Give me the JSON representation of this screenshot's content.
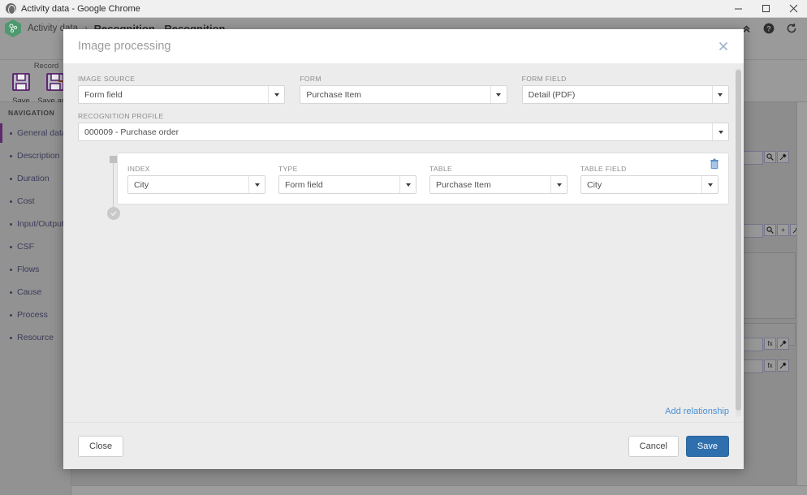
{
  "window": {
    "title": "Activity data - Google Chrome",
    "globe_icon": "chrome-globe-icon",
    "minimize": "–",
    "maximize": "☐",
    "close": "✕"
  },
  "app": {
    "breadcrumb_root": "Activity data",
    "breadcrumb_sep": "›",
    "breadcrumb_current": "Recognition - Recognition",
    "header_icons": [
      "collapse-up-icon",
      "help-icon",
      "refresh-icon"
    ],
    "ribbon": {
      "group_label": "Record",
      "buttons": [
        {
          "label": "Save",
          "icon": "save-icon"
        },
        {
          "label": "Save and c",
          "icon": "save-and-close-icon"
        }
      ]
    },
    "sidebar": {
      "title": "NAVIGATION",
      "items": [
        {
          "label": "General data",
          "active": true
        },
        {
          "label": "Description",
          "active": false
        },
        {
          "label": "Duration",
          "active": false
        },
        {
          "label": "Cost",
          "active": false
        },
        {
          "label": "Input/Output",
          "active": false
        },
        {
          "label": "CSF",
          "active": false
        },
        {
          "label": "Flows",
          "active": false
        },
        {
          "label": "Cause",
          "active": false
        },
        {
          "label": "Process",
          "active": false
        },
        {
          "label": "Resource",
          "active": false
        }
      ]
    },
    "background_icons": {
      "search": "⚲",
      "picker": "✒",
      "plus": "+",
      "fx": "fx"
    }
  },
  "dialog": {
    "title": "Image processing",
    "close_icon": "close-icon",
    "fields": [
      {
        "label": "IMAGE SOURCE",
        "value": "Form field"
      },
      {
        "label": "FORM",
        "value": "Purchase Item"
      },
      {
        "label": "FORM FIELD",
        "value": "Detail (PDF)"
      }
    ],
    "profile": {
      "label": "RECOGNITION PROFILE",
      "value": "000009 - Purchase order"
    },
    "relationship": {
      "delete_icon": "trash-icon",
      "status_icon": "check-circle-icon",
      "node_icon": "node-square-icon",
      "fields": [
        {
          "label": "INDEX",
          "value": "City"
        },
        {
          "label": "TYPE",
          "value": "Form field"
        },
        {
          "label": "TABLE",
          "value": "Purchase Item"
        },
        {
          "label": "TABLE FIELD",
          "value": "City"
        }
      ]
    },
    "add_relationship_label": "Add relationship",
    "buttons": {
      "close": "Close",
      "cancel": "Cancel",
      "save": "Save"
    },
    "accent_color": "#2f6fae",
    "link_color": "#4a8fd4"
  }
}
